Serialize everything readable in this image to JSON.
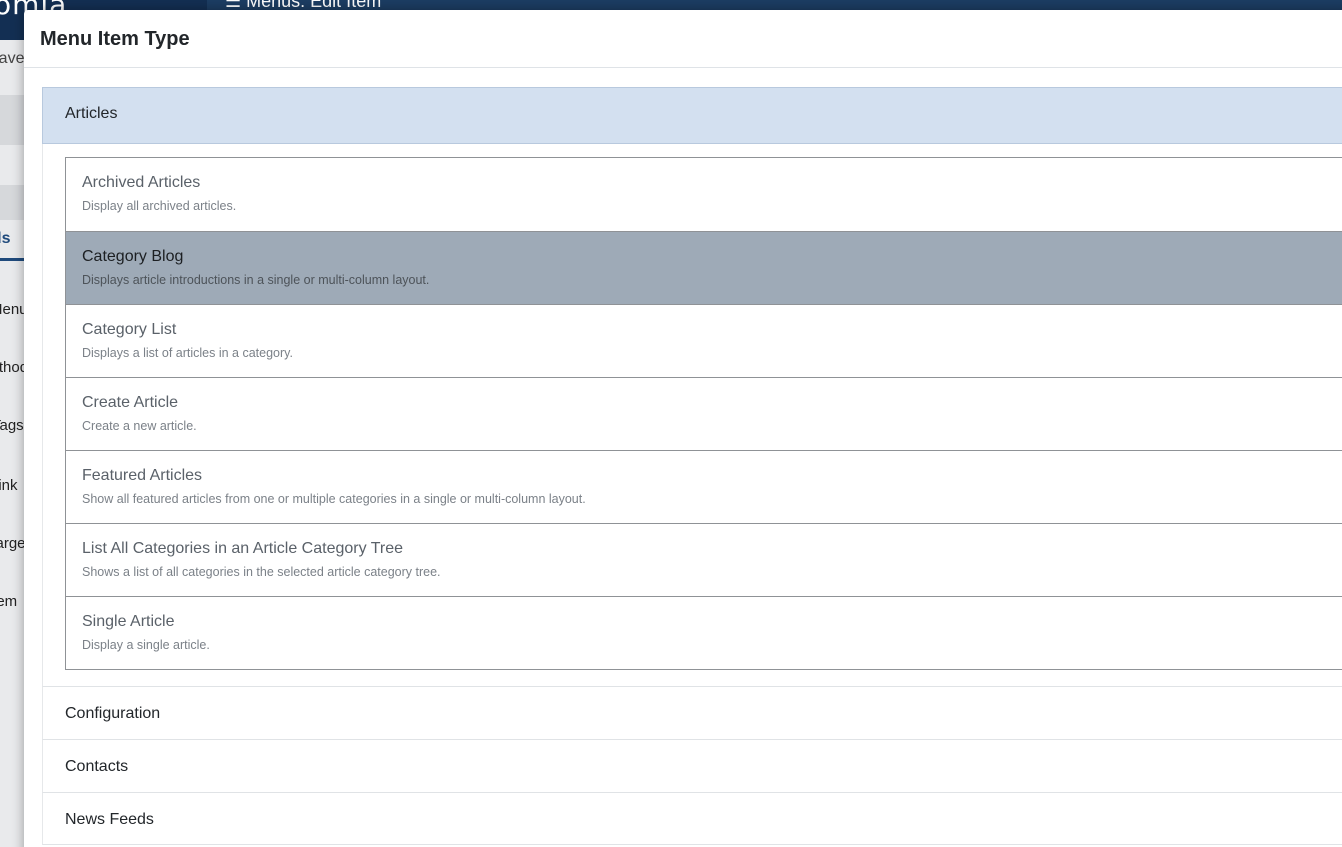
{
  "background": {
    "logo_text": "omla.",
    "page_title": "Menus: Edit Item",
    "toolbar_save": "Save",
    "tab_details": "Details",
    "field_labels": [
      "Menu",
      "Method",
      "Tags",
      "Link",
      "Target",
      "Item"
    ]
  },
  "modal": {
    "title": "Menu Item Type",
    "open_section": "Articles",
    "items": [
      {
        "title": "Archived Articles",
        "desc": "Display all archived articles."
      },
      {
        "title": "Category Blog",
        "desc": "Displays article introductions in a single or multi-column layout."
      },
      {
        "title": "Category List",
        "desc": "Displays a list of articles in a category."
      },
      {
        "title": "Create Article",
        "desc": "Create a new article."
      },
      {
        "title": "Featured Articles",
        "desc": "Show all featured articles from one or multiple categories in a single or multi-column layout."
      },
      {
        "title": "List All Categories in an Article Category Tree",
        "desc": "Shows a list of all categories in the selected article category tree."
      },
      {
        "title": "Single Article",
        "desc": "Display a single article."
      }
    ],
    "sections": [
      "Configuration",
      "Contacts",
      "News Feeds"
    ]
  }
}
